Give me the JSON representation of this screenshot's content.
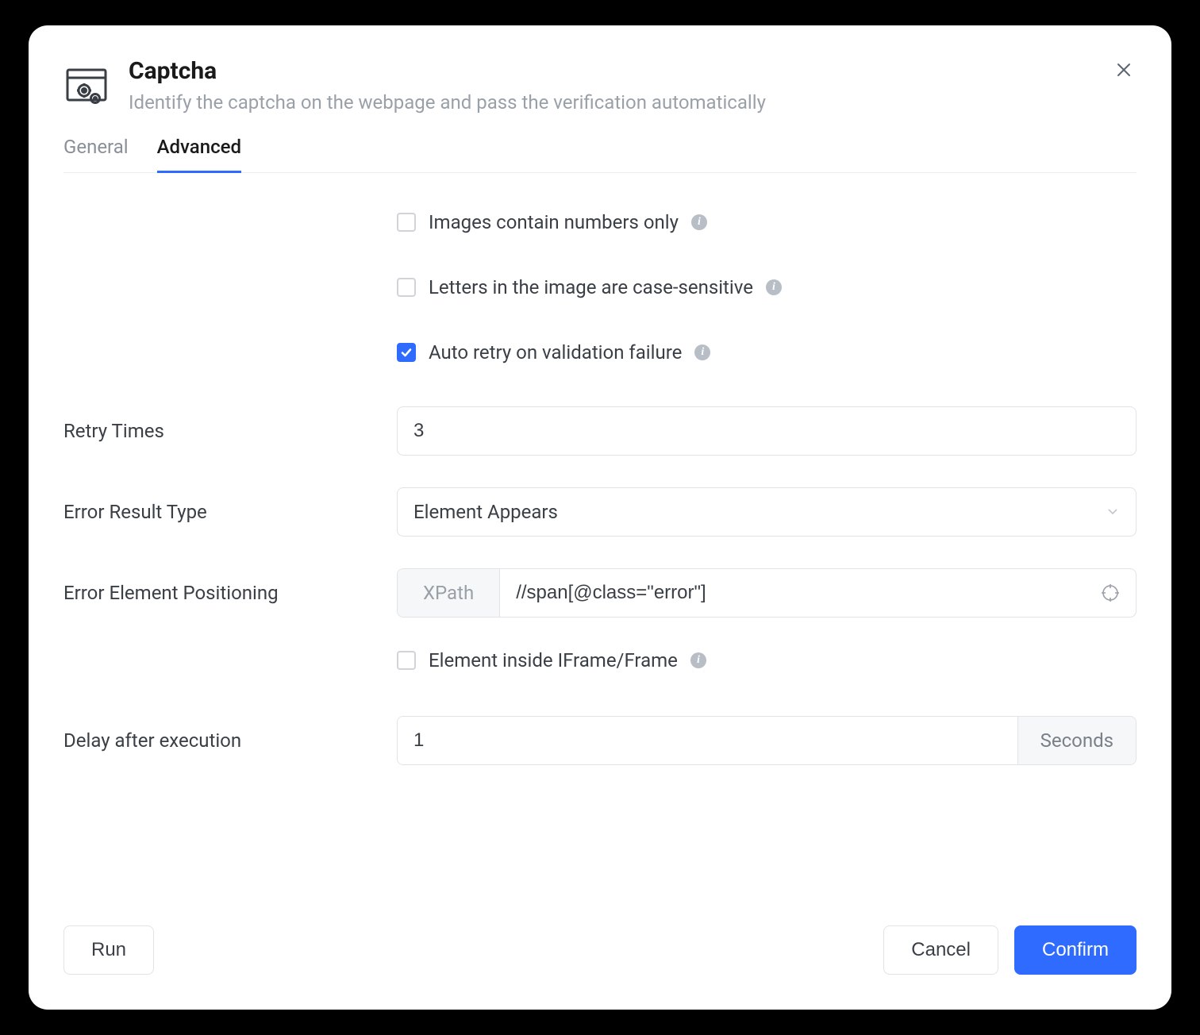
{
  "header": {
    "title": "Captcha",
    "subtitle": "Identify the captcha on the webpage and pass the verification automatically"
  },
  "tabs": {
    "general": "General",
    "advanced": "Advanced",
    "active": "advanced"
  },
  "options": {
    "numbers_only": {
      "label": "Images contain numbers only",
      "checked": false
    },
    "case_sensitive": {
      "label": "Letters in the image are case-sensitive",
      "checked": false
    },
    "auto_retry": {
      "label": "Auto retry on validation failure",
      "checked": true
    },
    "iframe": {
      "label": "Element inside IFrame/Frame",
      "checked": false
    }
  },
  "fields": {
    "retry_times": {
      "label": "Retry Times",
      "value": "3"
    },
    "error_result_type": {
      "label": "Error Result Type",
      "value": "Element Appears"
    },
    "error_element_positioning": {
      "label": "Error Element Positioning",
      "prefix": "XPath",
      "value": "//span[@class=\"error\"]"
    },
    "delay": {
      "label": "Delay after execution",
      "value": "1",
      "unit": "Seconds"
    }
  },
  "buttons": {
    "run": "Run",
    "cancel": "Cancel",
    "confirm": "Confirm"
  }
}
